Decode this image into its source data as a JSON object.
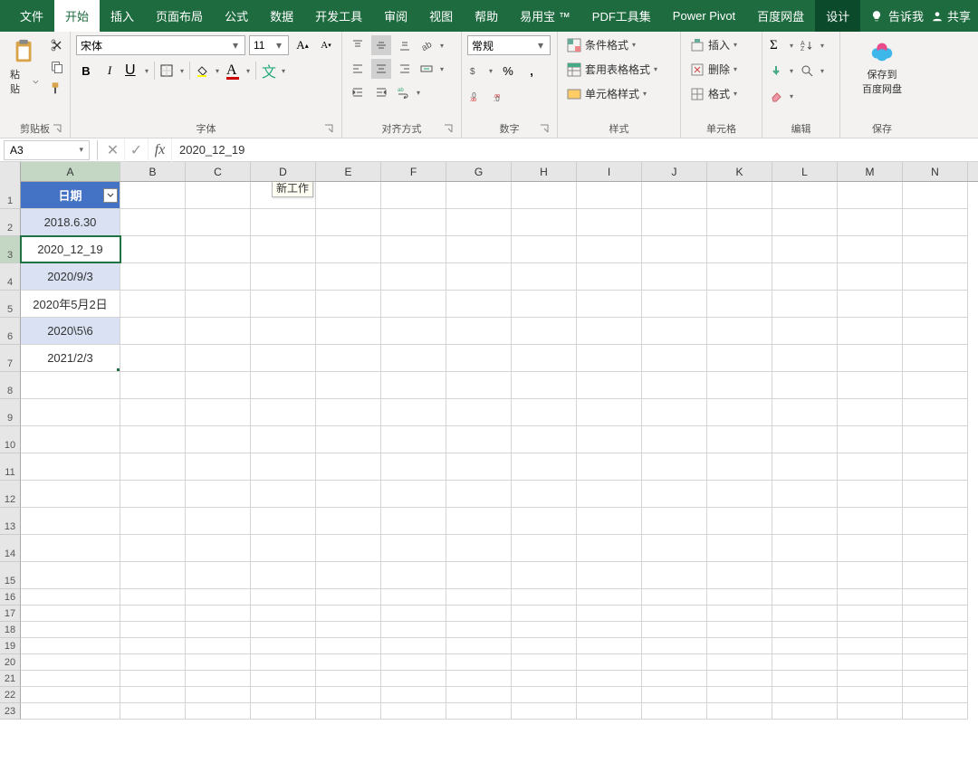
{
  "tabs": {
    "file": "文件",
    "home": "开始",
    "insert": "插入",
    "pageLayout": "页面布局",
    "formulas": "公式",
    "data": "数据",
    "dev": "开发工具",
    "review": "审阅",
    "view": "视图",
    "help": "帮助",
    "yiyongbao": "易用宝 ™",
    "pdf": "PDF工具集",
    "powerpivot": "Power Pivot",
    "baidu": "百度网盘",
    "design": "设计",
    "tellme": "告诉我",
    "share": "共享"
  },
  "ribbon": {
    "clipboard": {
      "paste": "粘贴",
      "label": "剪贴板"
    },
    "font": {
      "name": "宋体",
      "size": "11",
      "label": "字体"
    },
    "align": {
      "label": "对齐方式"
    },
    "number": {
      "format": "常规",
      "label": "数字"
    },
    "styles": {
      "cond": "条件格式",
      "table": "套用表格格式",
      "cell": "单元格样式",
      "label": "样式"
    },
    "cells": {
      "insert": "插入",
      "delete": "删除",
      "format": "格式",
      "label": "单元格"
    },
    "editing": {
      "label": "编辑"
    },
    "save": {
      "saveto": "保存到",
      "baidu": "百度网盘",
      "label": "保存"
    }
  },
  "nameBox": "A3",
  "formula": "2020_12_19",
  "tooltip": "新工作",
  "columns": [
    "A",
    "B",
    "C",
    "D",
    "E",
    "F",
    "G",
    "H",
    "I",
    "J",
    "K",
    "L",
    "M",
    "N"
  ],
  "colHeader": "日期",
  "rows": {
    "r2": "2018.6.30",
    "r3": "2020_12_19",
    "r4": "2020/9/3",
    "r5": "2020年5月2日",
    "r6": "2020\\5\\6",
    "r7": "2021/2/3"
  }
}
